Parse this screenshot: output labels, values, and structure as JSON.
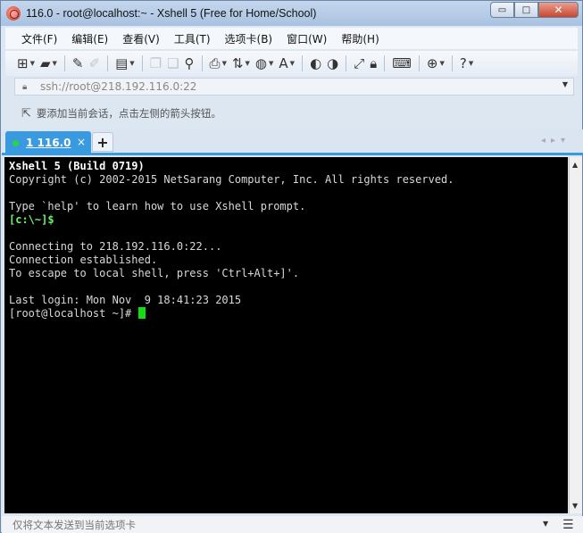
{
  "window": {
    "title": "116.0 - root@localhost:~ - Xshell 5 (Free for Home/School)",
    "controls": {
      "minimize": "▭",
      "maximize": "□",
      "close": "✕"
    }
  },
  "menu": [
    "文件(F)",
    "编辑(E)",
    "查看(V)",
    "工具(T)",
    "选项卡(B)",
    "窗口(W)",
    "帮助(H)"
  ],
  "toolbar": {
    "icons": [
      "new-session-icon",
      "open-folder-icon",
      "pencil-icon",
      "eraser-icon",
      "properties-icon",
      "copy-icon",
      "paste-icon",
      "find-icon",
      "print-icon",
      "transfer-icon",
      "globe-icon",
      "font-icon",
      "xftp-icon",
      "xmanager-icon",
      "fullscreen-icon",
      "lock-icon",
      "keyboard-icon",
      "add-window-icon",
      "help-icon"
    ]
  },
  "address": {
    "value": "ssh://root@218.192.116.0:22"
  },
  "hint": {
    "text": "要添加当前会话，点击左侧的箭头按钮。"
  },
  "tabs": [
    {
      "label": "1 116.0",
      "active": true
    }
  ],
  "terminal": {
    "lines": [
      {
        "text": "Xshell 5 (Build 0719)",
        "style": "bold"
      },
      {
        "text": "Copyright (c) 2002-2015 NetSarang Computer, Inc. All rights reserved.",
        "style": "normal"
      },
      {
        "text": "",
        "style": "normal"
      },
      {
        "text": "Type `help' to learn how to use Xshell prompt.",
        "style": "normal"
      },
      {
        "text": "[c:\\~]$",
        "style": "green"
      },
      {
        "text": "",
        "style": "normal"
      },
      {
        "text": "Connecting to 218.192.116.0:22...",
        "style": "normal"
      },
      {
        "text": "Connection established.",
        "style": "normal"
      },
      {
        "text": "To escape to local shell, press 'Ctrl+Alt+]'.",
        "style": "normal"
      },
      {
        "text": "",
        "style": "normal"
      },
      {
        "text": "Last login: Mon Nov  9 18:41:23 2015",
        "style": "normal"
      }
    ],
    "prompt": "[root@localhost ~]# "
  },
  "compose": {
    "placeholder": "仅将文本发送到当前选项卡"
  },
  "colors": {
    "tab_accent": "#3a9ae0",
    "cursor": "#10e010",
    "terminal_bg": "#000000"
  }
}
